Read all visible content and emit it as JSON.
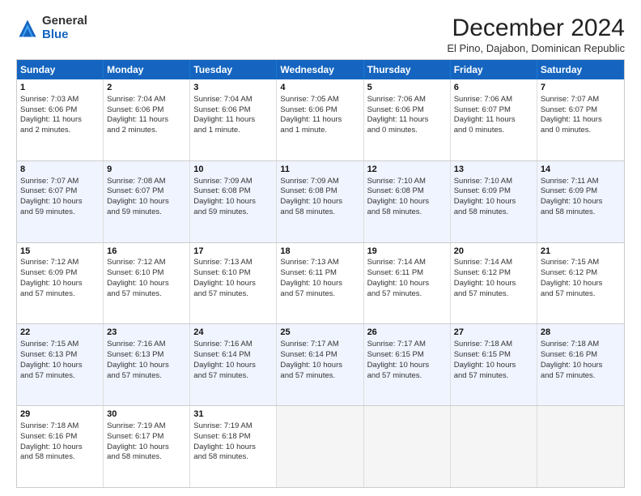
{
  "logo": {
    "general": "General",
    "blue": "Blue"
  },
  "title": "December 2024",
  "subtitle": "El Pino, Dajabon, Dominican Republic",
  "days": [
    "Sunday",
    "Monday",
    "Tuesday",
    "Wednesday",
    "Thursday",
    "Friday",
    "Saturday"
  ],
  "rows": [
    [
      {
        "day": "1",
        "info": "Sunrise: 7:03 AM\nSunset: 6:06 PM\nDaylight: 11 hours\nand 2 minutes."
      },
      {
        "day": "2",
        "info": "Sunrise: 7:04 AM\nSunset: 6:06 PM\nDaylight: 11 hours\nand 2 minutes."
      },
      {
        "day": "3",
        "info": "Sunrise: 7:04 AM\nSunset: 6:06 PM\nDaylight: 11 hours\nand 1 minute."
      },
      {
        "day": "4",
        "info": "Sunrise: 7:05 AM\nSunset: 6:06 PM\nDaylight: 11 hours\nand 1 minute."
      },
      {
        "day": "5",
        "info": "Sunrise: 7:06 AM\nSunset: 6:06 PM\nDaylight: 11 hours\nand 0 minutes."
      },
      {
        "day": "6",
        "info": "Sunrise: 7:06 AM\nSunset: 6:07 PM\nDaylight: 11 hours\nand 0 minutes."
      },
      {
        "day": "7",
        "info": "Sunrise: 7:07 AM\nSunset: 6:07 PM\nDaylight: 11 hours\nand 0 minutes."
      }
    ],
    [
      {
        "day": "8",
        "info": "Sunrise: 7:07 AM\nSunset: 6:07 PM\nDaylight: 10 hours\nand 59 minutes."
      },
      {
        "day": "9",
        "info": "Sunrise: 7:08 AM\nSunset: 6:07 PM\nDaylight: 10 hours\nand 59 minutes."
      },
      {
        "day": "10",
        "info": "Sunrise: 7:09 AM\nSunset: 6:08 PM\nDaylight: 10 hours\nand 59 minutes."
      },
      {
        "day": "11",
        "info": "Sunrise: 7:09 AM\nSunset: 6:08 PM\nDaylight: 10 hours\nand 58 minutes."
      },
      {
        "day": "12",
        "info": "Sunrise: 7:10 AM\nSunset: 6:08 PM\nDaylight: 10 hours\nand 58 minutes."
      },
      {
        "day": "13",
        "info": "Sunrise: 7:10 AM\nSunset: 6:09 PM\nDaylight: 10 hours\nand 58 minutes."
      },
      {
        "day": "14",
        "info": "Sunrise: 7:11 AM\nSunset: 6:09 PM\nDaylight: 10 hours\nand 58 minutes."
      }
    ],
    [
      {
        "day": "15",
        "info": "Sunrise: 7:12 AM\nSunset: 6:09 PM\nDaylight: 10 hours\nand 57 minutes."
      },
      {
        "day": "16",
        "info": "Sunrise: 7:12 AM\nSunset: 6:10 PM\nDaylight: 10 hours\nand 57 minutes."
      },
      {
        "day": "17",
        "info": "Sunrise: 7:13 AM\nSunset: 6:10 PM\nDaylight: 10 hours\nand 57 minutes."
      },
      {
        "day": "18",
        "info": "Sunrise: 7:13 AM\nSunset: 6:11 PM\nDaylight: 10 hours\nand 57 minutes."
      },
      {
        "day": "19",
        "info": "Sunrise: 7:14 AM\nSunset: 6:11 PM\nDaylight: 10 hours\nand 57 minutes."
      },
      {
        "day": "20",
        "info": "Sunrise: 7:14 AM\nSunset: 6:12 PM\nDaylight: 10 hours\nand 57 minutes."
      },
      {
        "day": "21",
        "info": "Sunrise: 7:15 AM\nSunset: 6:12 PM\nDaylight: 10 hours\nand 57 minutes."
      }
    ],
    [
      {
        "day": "22",
        "info": "Sunrise: 7:15 AM\nSunset: 6:13 PM\nDaylight: 10 hours\nand 57 minutes."
      },
      {
        "day": "23",
        "info": "Sunrise: 7:16 AM\nSunset: 6:13 PM\nDaylight: 10 hours\nand 57 minutes."
      },
      {
        "day": "24",
        "info": "Sunrise: 7:16 AM\nSunset: 6:14 PM\nDaylight: 10 hours\nand 57 minutes."
      },
      {
        "day": "25",
        "info": "Sunrise: 7:17 AM\nSunset: 6:14 PM\nDaylight: 10 hours\nand 57 minutes."
      },
      {
        "day": "26",
        "info": "Sunrise: 7:17 AM\nSunset: 6:15 PM\nDaylight: 10 hours\nand 57 minutes."
      },
      {
        "day": "27",
        "info": "Sunrise: 7:18 AM\nSunset: 6:15 PM\nDaylight: 10 hours\nand 57 minutes."
      },
      {
        "day": "28",
        "info": "Sunrise: 7:18 AM\nSunset: 6:16 PM\nDaylight: 10 hours\nand 57 minutes."
      }
    ],
    [
      {
        "day": "29",
        "info": "Sunrise: 7:18 AM\nSunset: 6:16 PM\nDaylight: 10 hours\nand 58 minutes."
      },
      {
        "day": "30",
        "info": "Sunrise: 7:19 AM\nSunset: 6:17 PM\nDaylight: 10 hours\nand 58 minutes."
      },
      {
        "day": "31",
        "info": "Sunrise: 7:19 AM\nSunset: 6:18 PM\nDaylight: 10 hours\nand 58 minutes."
      },
      {
        "day": "",
        "info": ""
      },
      {
        "day": "",
        "info": ""
      },
      {
        "day": "",
        "info": ""
      },
      {
        "day": "",
        "info": ""
      }
    ]
  ],
  "alt_rows": [
    1,
    3
  ]
}
